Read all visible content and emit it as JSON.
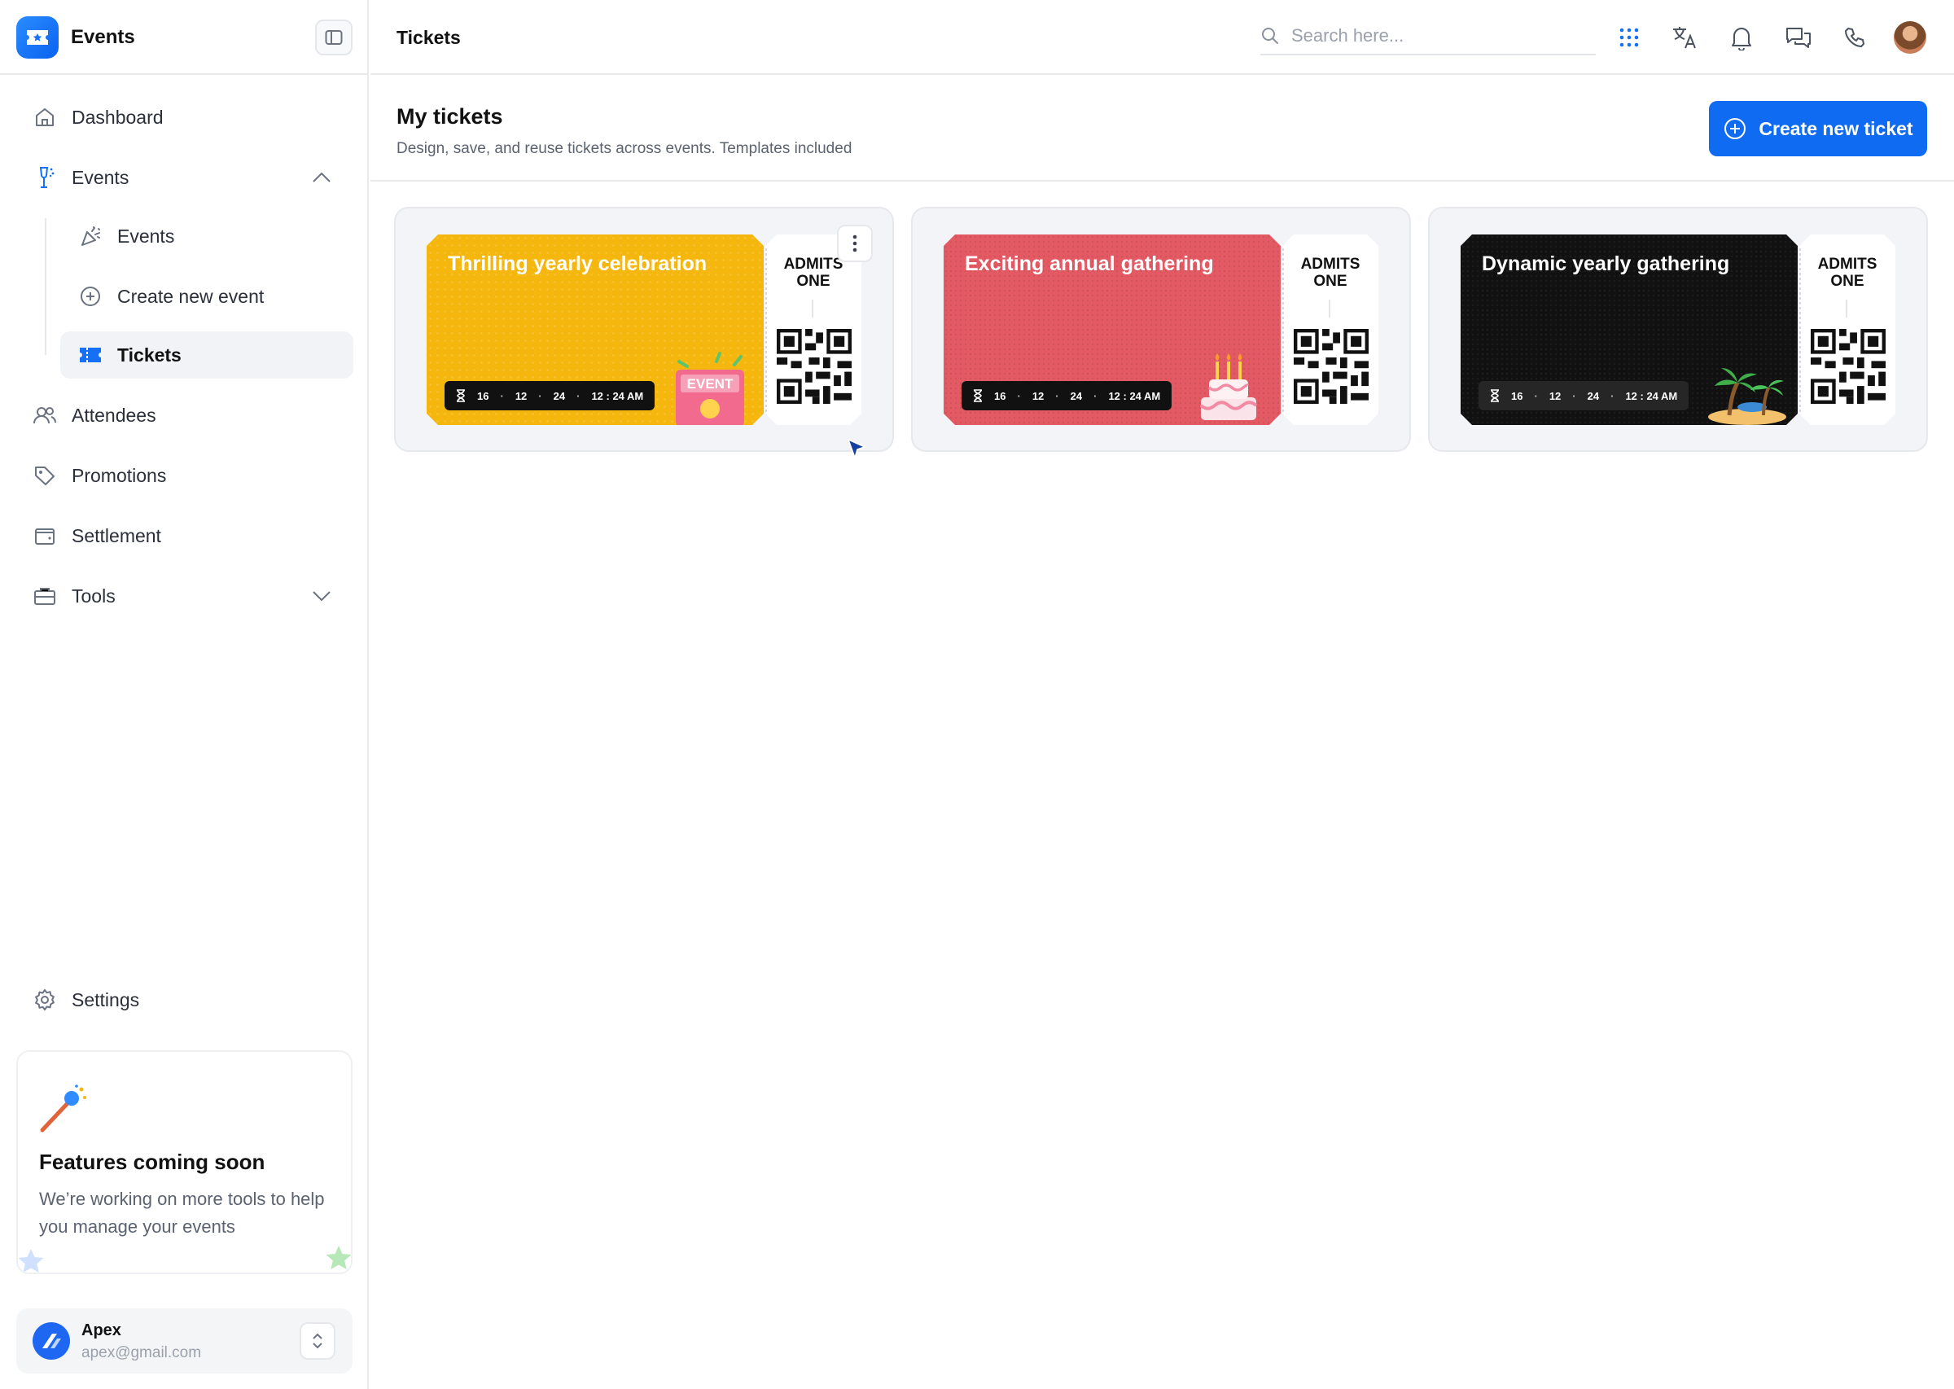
{
  "app": {
    "name": "Events"
  },
  "sidebar": {
    "items": {
      "dashboard": "Dashboard",
      "events": "Events",
      "attendees": "Attendees",
      "promotions": "Promotions",
      "settlement": "Settlement",
      "tools": "Tools",
      "settings": "Settings"
    },
    "events_sub": {
      "events": "Events",
      "create_event": "Create new event",
      "tickets": "Tickets"
    },
    "promo": {
      "title": "Features coming soon",
      "text": "We’re working on more tools to help you manage your events"
    },
    "user": {
      "name": "Apex",
      "email": "apex@gmail.com"
    }
  },
  "topbar": {
    "page": "Tickets",
    "search_placeholder": "Search here..."
  },
  "header": {
    "title": "My tickets",
    "subtitle": "Design, save, and reuse tickets across events. Templates included",
    "create_label": "Create new ticket"
  },
  "tickets": [
    {
      "title": "Thrilling yearly celebration",
      "day": "16",
      "month": "12",
      "year": "24",
      "time": "12 : 24 AM",
      "stub": "ADMITS ONE",
      "theme": "#f5b70d",
      "art": "event-sign-icon",
      "badge": "EVENT"
    },
    {
      "title": "Exciting annual gathering",
      "day": "16",
      "month": "12",
      "year": "24",
      "time": "12 : 24 AM",
      "stub": "ADMITS ONE",
      "theme": "#e35a64",
      "art": "birthday-cake-icon"
    },
    {
      "title": "Dynamic yearly gathering",
      "day": "16",
      "month": "12",
      "year": "24",
      "time": "12 : 24 AM",
      "stub": "ADMITS ONE",
      "theme": "#111111",
      "art": "palm-island-icon"
    }
  ]
}
